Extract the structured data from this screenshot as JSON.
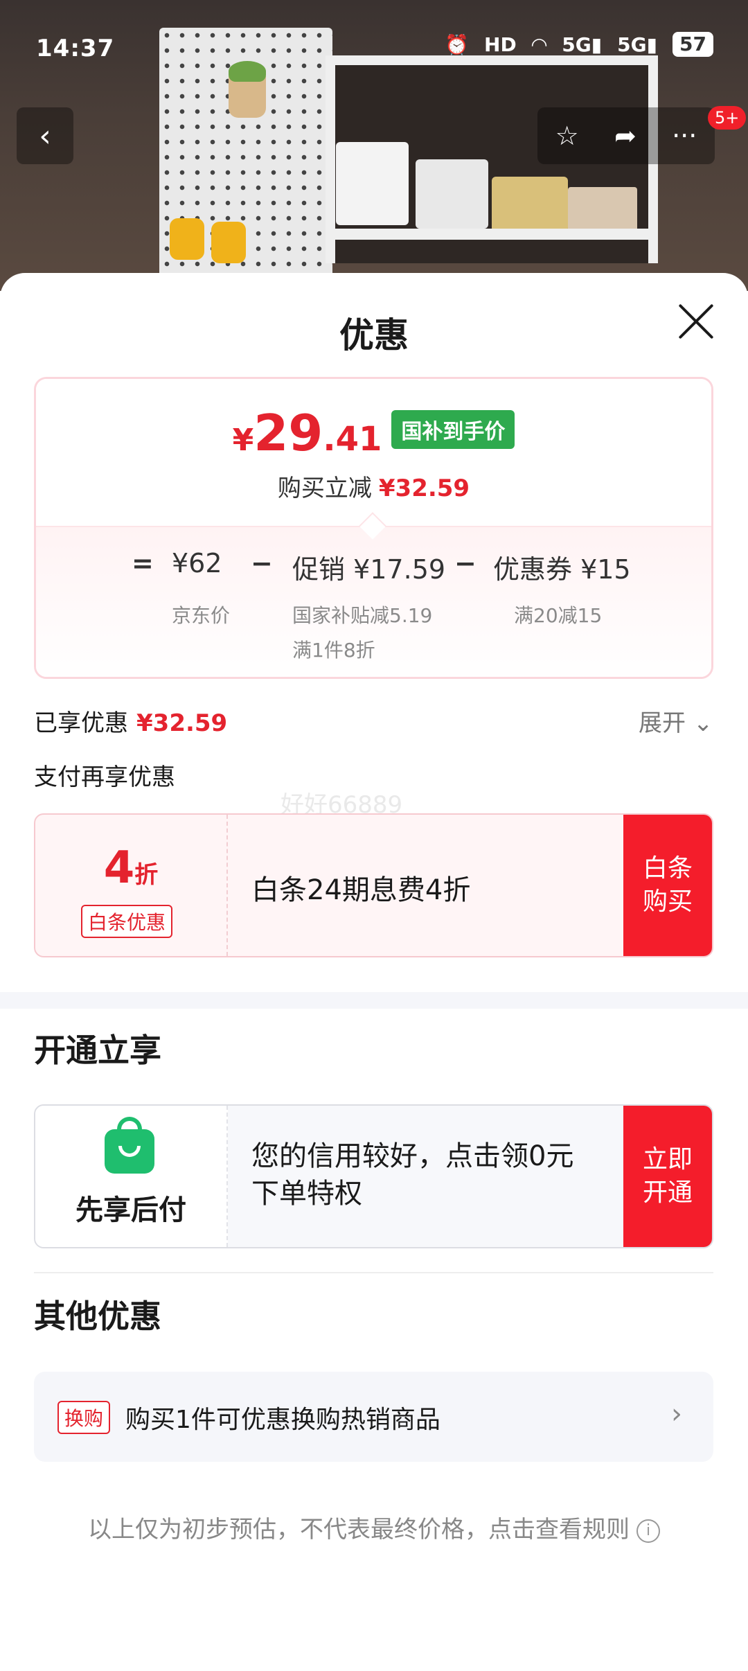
{
  "status_bar": {
    "time": "14:37",
    "icons": [
      "alarm-icon",
      "hd-icon",
      "wifi-icon",
      "5g-signal-icon",
      "5g-signal-icon"
    ],
    "battery": "57"
  },
  "nav": {
    "badge": "5+"
  },
  "sheet": {
    "title": "优惠"
  },
  "price_card": {
    "yen": "¥",
    "price_int": "29",
    "price_dec": ".41",
    "tag": "国补到手价",
    "sub_label": "购买立减",
    "sub_amount": "¥32.59",
    "formula": {
      "eq": "=",
      "jd_price": "¥62",
      "minus1": "−",
      "promo": "促销 ¥17.59",
      "minus2": "−",
      "coupon": "优惠券 ¥15",
      "jd_price_label": "京东价",
      "promo_line1": "国家补贴减5.19",
      "promo_line2": "满1件8折",
      "coupon_label": "满20减15"
    }
  },
  "enjoyed": {
    "label": "已享优惠",
    "amount": "¥32.59",
    "expand": "展开"
  },
  "pay_more": "支付再享优惠",
  "watermark": "好好66889",
  "baitiao": {
    "discount_num": "4",
    "discount_unit": "折",
    "tag": "白条优惠",
    "text": "白条24期息费4折",
    "button_line1": "白条",
    "button_line2": "购买"
  },
  "kaitong": {
    "title": "开通立享",
    "brand": "先享后付",
    "text_line1": "您的信用较好，点击领0元",
    "text_line2": "下单特权",
    "button_line1": "立即",
    "button_line2": "开通"
  },
  "other": {
    "title": "其他优惠",
    "tag": "换购",
    "text": "购买1件可优惠换购热销商品"
  },
  "footnote": "以上仅为初步预估，不代表最终价格，点击查看规则",
  "colors": {
    "accent_red": "#e4232e",
    "button_red": "#f41d2b",
    "green_tag": "#2eaa4e",
    "brand_green": "#1fbe6e"
  }
}
